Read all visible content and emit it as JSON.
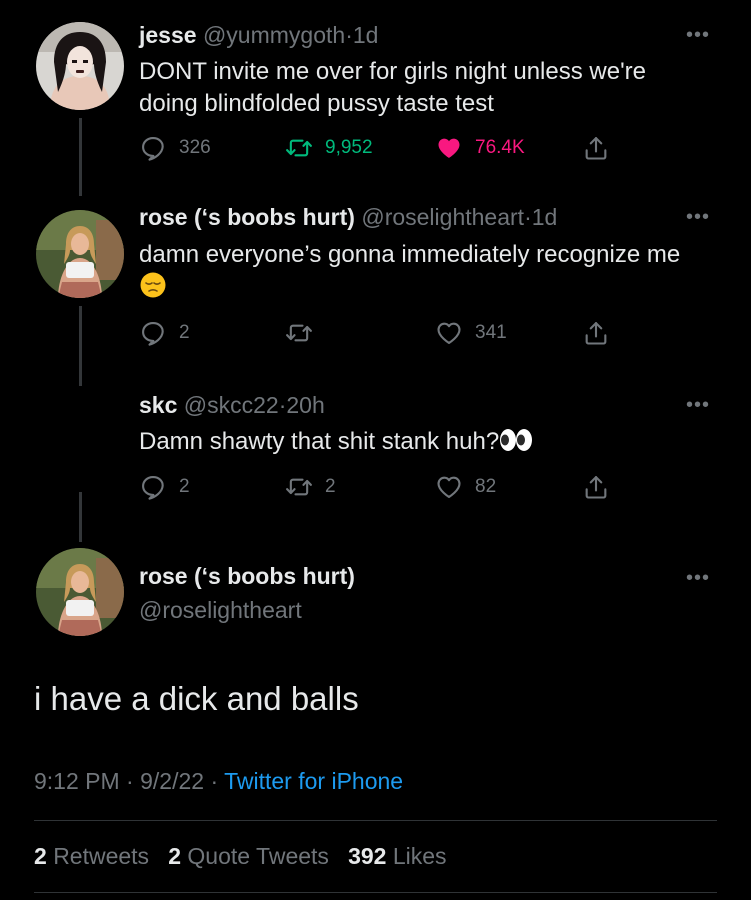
{
  "tweets": [
    {
      "name": "jesse",
      "handle": "@yummygoth",
      "sep": "·",
      "time": "1d",
      "text": "DONT invite me over for girls night unless we're doing blindfolded pussy taste test",
      "replies": "326",
      "retweets": "9,952",
      "likes": "76.4K",
      "liked": true,
      "retweeted": true
    },
    {
      "name": "rose (‘s boobs hurt)",
      "handle": "@roselightheart",
      "sep": "·",
      "time": "1d",
      "text": "damn everyone’s gonna immediately recognize me",
      "emoji": "pensive-face",
      "replies": "2",
      "retweets": "",
      "likes": "341"
    },
    {
      "name": "skc",
      "handle": "@skcc22",
      "sep": "·",
      "time": "20h",
      "text": "Damn shawty that shit stank huh?",
      "emoji": "eyes",
      "replies": "2",
      "retweets": "2",
      "likes": "82"
    }
  ],
  "main": {
    "name": "rose (‘s boobs hurt)",
    "handle": "@roselightheart",
    "text": "i have a dick and balls",
    "time": "9:12 PM",
    "date": "9/2/22",
    "sep": "·",
    "source": "Twitter for iPhone",
    "retweets_count": "2",
    "retweets_label": "Retweets",
    "quotes_count": "2",
    "quotes_label": "Quote Tweets",
    "likes_count": "392",
    "likes_label": "Likes"
  },
  "more_glyph": "•••",
  "colors": {
    "background": "#000000",
    "text": "#e7e9ea",
    "muted": "#71767b",
    "link": "#1d9bf0",
    "retweet": "#00ba7c",
    "like": "#f91880"
  },
  "icons": [
    "reply-icon",
    "retweet-icon",
    "like-icon",
    "share-icon",
    "more-icon"
  ]
}
